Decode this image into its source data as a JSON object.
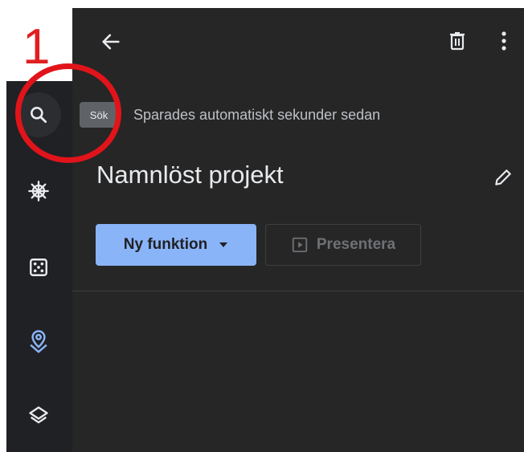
{
  "annotation": {
    "step_number": "1"
  },
  "sidebar": {
    "items": [
      {
        "icon": "search-icon",
        "tooltip": "Sök"
      },
      {
        "icon": "ship-wheel-icon"
      },
      {
        "icon": "dice-icon"
      },
      {
        "icon": "map-pin-icon"
      },
      {
        "icon": "layers-icon"
      }
    ]
  },
  "header": {
    "back_icon": "arrow-left-icon",
    "delete_icon": "trash-icon",
    "more_icon": "more-vert-icon"
  },
  "project": {
    "autosave_status": "Sparades automatiskt sekunder sedan",
    "title": "Namnlöst projekt",
    "edit_icon": "pencil-icon"
  },
  "actions": {
    "new_feature_label": "Ny funktion",
    "present_label": "Presentera"
  },
  "colors": {
    "accent": "#8ab4f8",
    "annotation_red": "#e0141a",
    "panel_bg": "#262626",
    "rail_bg": "#202124"
  }
}
